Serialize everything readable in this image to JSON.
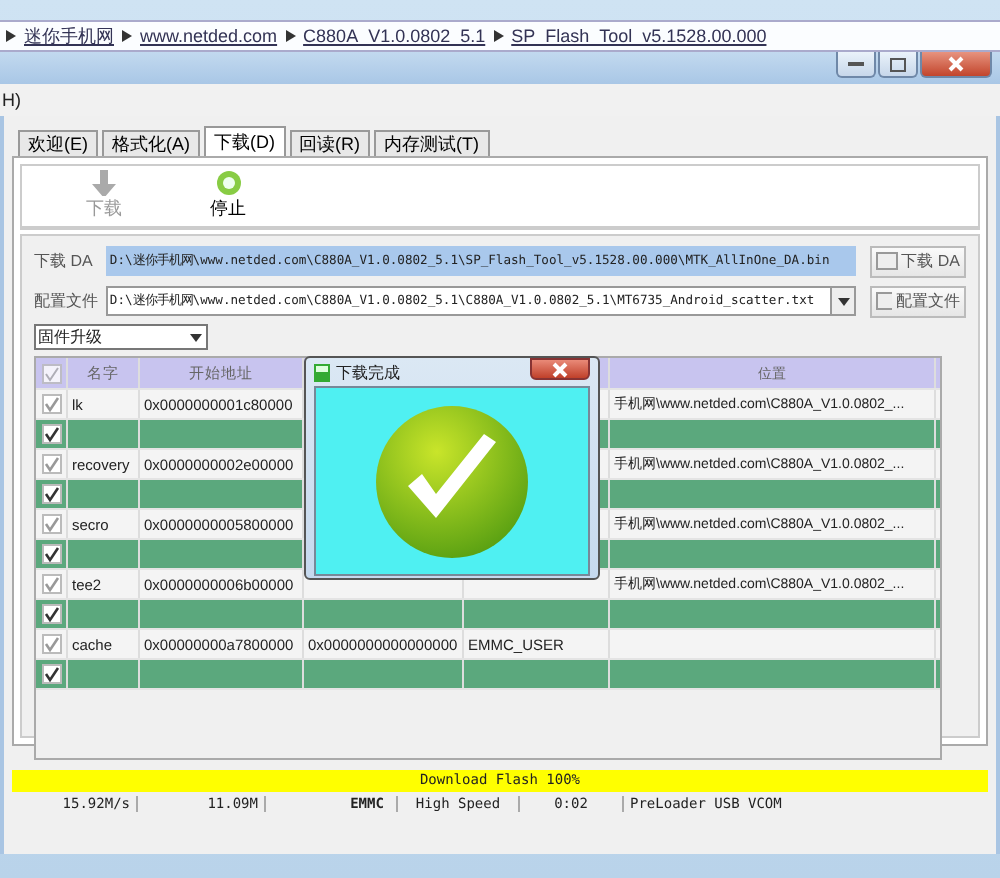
{
  "breadcrumb": [
    "迷你手机网",
    "www.netded.com",
    "C880A_V1.0.0802_5.1",
    "SP_Flash_Tool_v5.1528.00.000"
  ],
  "menu": [
    "H)"
  ],
  "tabs": [
    {
      "label": "欢迎(E)",
      "selected": false
    },
    {
      "label": "格式化(A)",
      "selected": false
    },
    {
      "label": "下载(D)",
      "selected": true
    },
    {
      "label": "回读(R)",
      "selected": false
    },
    {
      "label": "内存测试(T)",
      "selected": false
    }
  ],
  "toolbar": [
    {
      "label": "下载",
      "kind": "download",
      "disabled": true
    },
    {
      "label": "停止",
      "kind": "stop",
      "disabled": false
    }
  ],
  "fields": [
    {
      "label": "下载 DA",
      "value": "D:\\迷你手机网\\www.netded.com\\C880A_V1.0.0802_5.1\\SP_Flash_Tool_v5.1528.00.000\\MTK_AllInOne_DA.bin",
      "highlighted": true,
      "dropdown": false,
      "button": "下载 DA"
    },
    {
      "label": "配置文件",
      "value": "D:\\迷你手机网\\www.netded.com\\C880A_V1.0.0802_5.1\\C880A_V1.0.0802_5.1\\MT6735_Android_scatter.txt",
      "highlighted": false,
      "dropdown": true,
      "button": "配置文件"
    }
  ],
  "mode": {
    "value": "固件升级"
  },
  "table": {
    "header_checked": true,
    "columns": [
      "名字",
      "开始地址",
      "位置"
    ],
    "rows": [
      {
        "checked": true,
        "highlighted": false,
        "name": "lk",
        "start": "0x0000000001c80000",
        "location": "手机网\\www.netded.com\\C880A_V1.0.0802_..."
      },
      {
        "checked": true,
        "highlighted": true
      },
      {
        "checked": true,
        "highlighted": false,
        "name": "recovery",
        "start": "0x0000000002e00000",
        "location": "手机网\\www.netded.com\\C880A_V1.0.0802_..."
      },
      {
        "checked": true,
        "highlighted": true
      },
      {
        "checked": true,
        "highlighted": false,
        "name": "secro",
        "start": "0x0000000005800000",
        "location": "手机网\\www.netded.com\\C880A_V1.0.0802_..."
      },
      {
        "checked": true,
        "highlighted": true
      },
      {
        "checked": true,
        "highlighted": false,
        "name": "tee2",
        "start": "0x0000000006b00000",
        "location": "手机网\\www.netded.com\\C880A_V1.0.0802_..."
      },
      {
        "checked": true,
        "highlighted": true
      },
      {
        "checked": true,
        "highlighted": false,
        "name": "cache",
        "start": "0x00000000a7800000",
        "end": "0x0000000000000000",
        "region": "EMMC_USER"
      },
      {
        "checked": true,
        "highlighted": true
      }
    ]
  },
  "dialog": {
    "title": "下载完成"
  },
  "progress": {
    "label": "Download Flash 100%",
    "level": 1
  },
  "status_bar": [
    {
      "text": "15.92M/s",
      "bold": false
    },
    {
      "text": "11.09M",
      "bold": false
    },
    {
      "text": "EMMC",
      "bold": true
    },
    {
      "text": "High Speed",
      "bold": false
    },
    {
      "text": "0:02",
      "bold": false
    },
    {
      "text": "PreLoader USB VCOM",
      "bold": false
    }
  ]
}
